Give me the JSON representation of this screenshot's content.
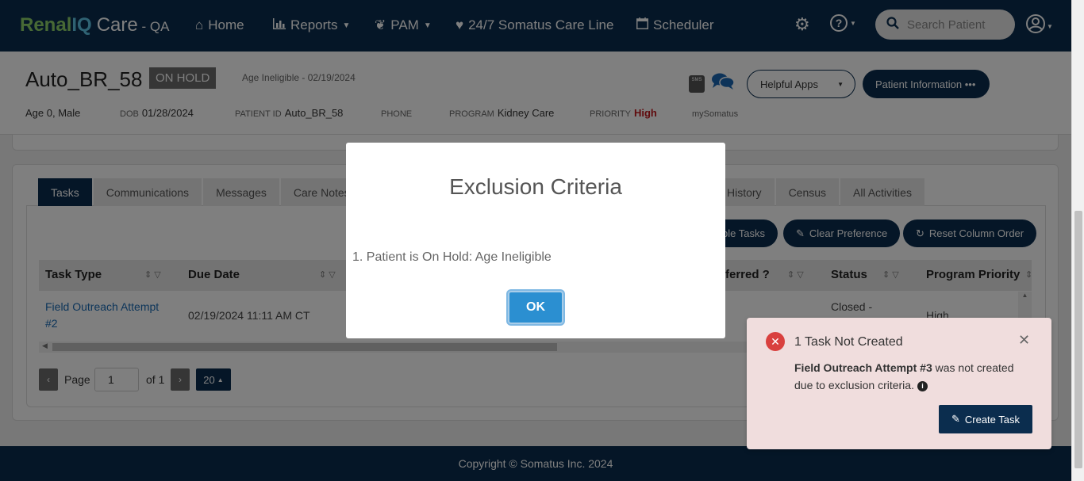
{
  "nav": {
    "brand_renal": "Renal",
    "brand_iq": "IQ",
    "brand_care": "Care",
    "brand_env": " - QA",
    "home": "Home",
    "reports": "Reports",
    "pam": "PAM",
    "careline": "24/7 Somatus Care Line",
    "scheduler": "Scheduler",
    "search_placeholder": "Search Patient"
  },
  "patient": {
    "name": "Auto_BR_58",
    "status_badge": "ON HOLD",
    "hold_reason": "Age Ineligible - 02/19/2024",
    "age_sex": "Age 0, Male",
    "dob_label": "DOB",
    "dob": "01/28/2024",
    "id_label": "PATIENT ID",
    "id": "Auto_BR_58",
    "phone_label": "PHONE",
    "program_label": "PROGRAM",
    "program": "Kidney Care",
    "priority_label": "PRIORITY",
    "priority": "High",
    "mysomatus": "mySomatus",
    "sms_icon_text": "SMS",
    "helpful_apps": "Helpful Apps",
    "patient_info": "Patient Information •••"
  },
  "tabs": {
    "tasks": "Tasks",
    "communications": "Communications",
    "messages": "Messages",
    "care_notes": "Care Notes",
    "history": "History",
    "census": "Census",
    "all_activities": "All Activities"
  },
  "actions": {
    "tasks_partial": "ble Tasks",
    "clear_preference": "Clear Preference",
    "reset_column_order": "Reset Column Order"
  },
  "table": {
    "headers": {
      "task_type": "Task Type",
      "due_date": "Due Date",
      "preferred": "ferred ?",
      "status": "Status",
      "program_priority": "Program Priority"
    },
    "rows": [
      {
        "task_type": "Field Outreach Attempt #2",
        "due_date": "02/19/2024 11:11 AM CT",
        "status": "Closed -",
        "program_priority": "High"
      }
    ]
  },
  "pager": {
    "page_label": "Page",
    "page_value": "1",
    "of_label": "of 1",
    "page_size": "20"
  },
  "footer": "Copyright © Somatus Inc. 2024",
  "modal": {
    "title": "Exclusion Criteria",
    "body": "1. Patient is On Hold: Age Ineligible",
    "ok": "OK"
  },
  "toast": {
    "title": "1 Task Not Created",
    "task_name": "Field Outreach Attempt #3",
    "message": " was not created due to exclusion criteria.",
    "info_glyph": "i",
    "create": "Create Task"
  },
  "colors": {
    "navy": "#0b2d4e",
    "brand_green": "#8fd26b",
    "brand_blue": "#5ec4e6",
    "priority_red": "#c0161b",
    "ok_blue": "#2b8fd1",
    "toast_bg": "#f0dddd",
    "toast_error": "#d9403e"
  }
}
